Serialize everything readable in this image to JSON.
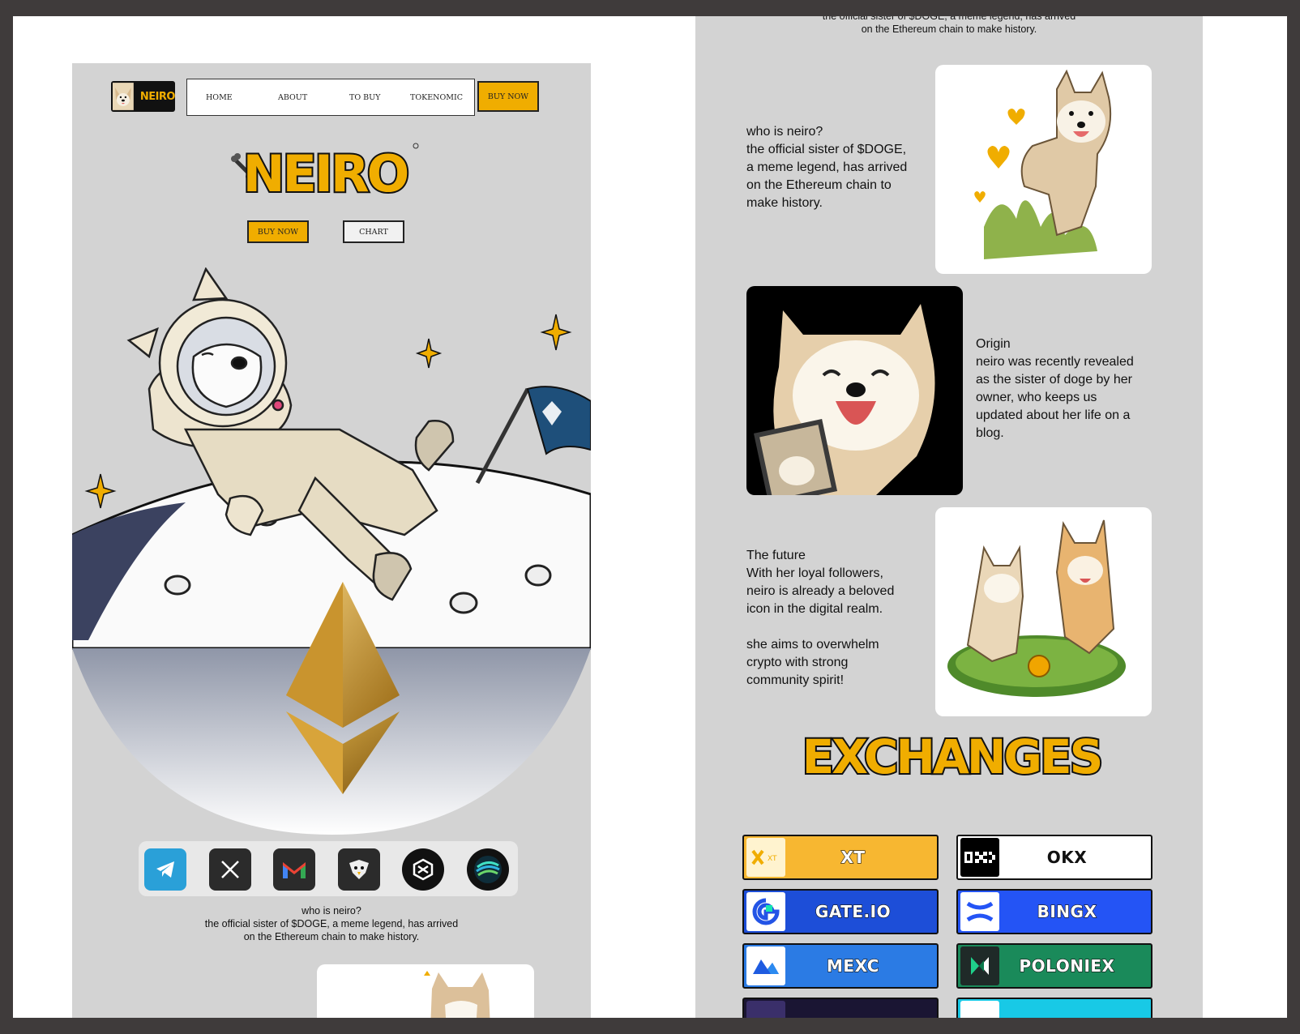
{
  "left_mockup": {
    "logo_text": "NEIRO",
    "nav": [
      "HOME",
      "ABOUT",
      "TO BUY",
      "TOKENOMIC"
    ],
    "header_buy": "BUY NOW",
    "hero_title": "NEIRO",
    "hero_buy": "BUY NOW",
    "hero_chart": "CHART",
    "socials": [
      "telegram-icon",
      "x-icon",
      "gmail-icon",
      "eagle-icon",
      "dextools-icon",
      "coingecko-icon"
    ],
    "intro": [
      "who is neiro?",
      "the official sister of $DOGE, a meme legend, has arrived",
      "on the Ethereum chain to make history."
    ]
  },
  "right_mockup": {
    "top_text": [
      "the official sister of $DOGE, a meme legend, has arrived",
      "on the Ethereum chain to make history."
    ],
    "section1": [
      "who is neiro?",
      "the official sister of $DOGE,",
      "a meme legend, has arrived",
      "on the Ethereum chain to",
      "make history."
    ],
    "section2": [
      "Origin",
      "neiro was recently revealed",
      "as the sister of doge by her",
      "owner, who keeps us",
      "updated about her life on a",
      "blog."
    ],
    "section3": [
      "The future",
      "With her loyal followers,",
      "neiro is already a beloved",
      "icon in the digital realm.",
      "",
      "she aims to overwhelm",
      "crypto with strong",
      "community spirit!"
    ],
    "exchanges_title": "EXCHANGES",
    "exchanges": [
      {
        "label": "XT",
        "color": "#f7b731"
      },
      {
        "label": "OKX",
        "color": "#ffffff"
      },
      {
        "label": "GATE.IO",
        "color": "#1d4ed8"
      },
      {
        "label": "BINGX",
        "color": "#2454f5"
      },
      {
        "label": "MEXC",
        "color": "#2b7be4"
      },
      {
        "label": "POLONIEX",
        "color": "#1a8a5a"
      }
    ]
  }
}
